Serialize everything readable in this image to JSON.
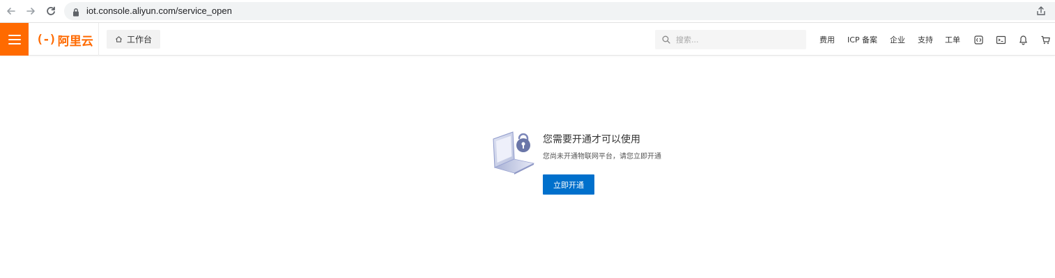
{
  "browser": {
    "url": "iot.console.aliyun.com/service_open"
  },
  "topbar": {
    "logo_mark": "(-)",
    "logo_text": "阿里云",
    "workbench_label": "工作台",
    "search_placeholder": "搜索...",
    "links": {
      "fees": "费用",
      "icp": "ICP 备案",
      "enterprise": "企业",
      "support": "支持",
      "ticket": "工单"
    },
    "accent_color": "#ff6a00"
  },
  "empty_state": {
    "title": "您需要开通才可以使用",
    "description": "您尚未开通物联网平台，请您立即开通",
    "button_label": "立即开通",
    "button_color": "#0070cc"
  }
}
